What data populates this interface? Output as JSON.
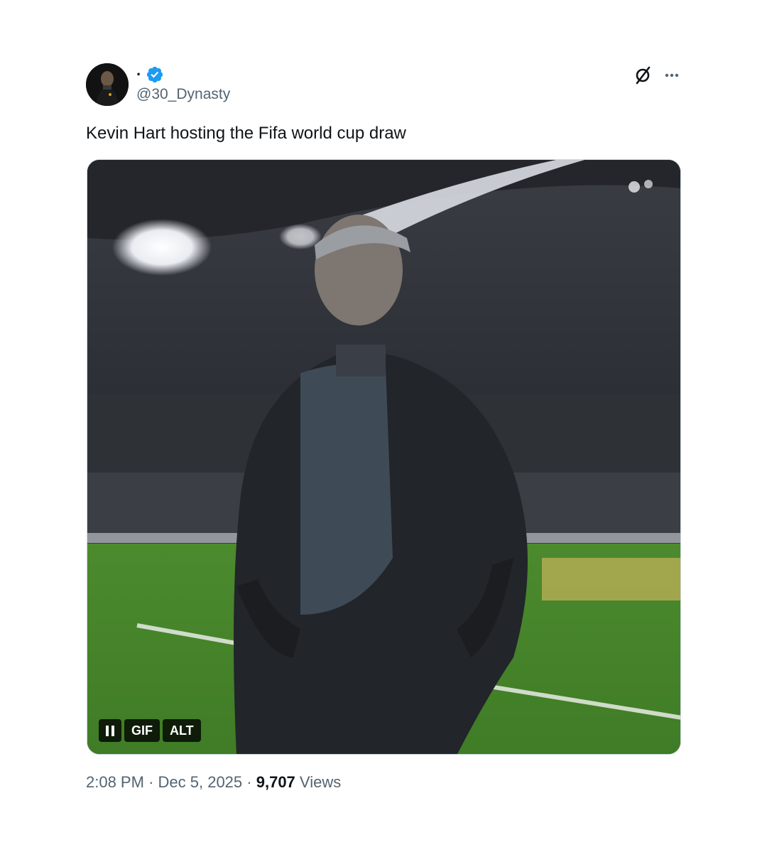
{
  "author": {
    "display_name": "·",
    "handle": "@30_Dynasty",
    "verified_color": "#1d9bf0"
  },
  "tweet": {
    "text": "Kevin Hart hosting the Fifa world cup draw"
  },
  "media": {
    "controls": {
      "pause_icon": "pause-icon",
      "gif_label": "GIF",
      "alt_label": "ALT"
    }
  },
  "meta": {
    "time": "2:08 PM",
    "separator": "·",
    "date": "Dec 5, 2025",
    "views_count": "9,707",
    "views_label": "Views"
  },
  "icons": {
    "grok": "grok-icon",
    "more": "more-icon"
  },
  "colors": {
    "text_primary": "#0f1419",
    "text_secondary": "#536471",
    "verified": "#1d9bf0"
  }
}
